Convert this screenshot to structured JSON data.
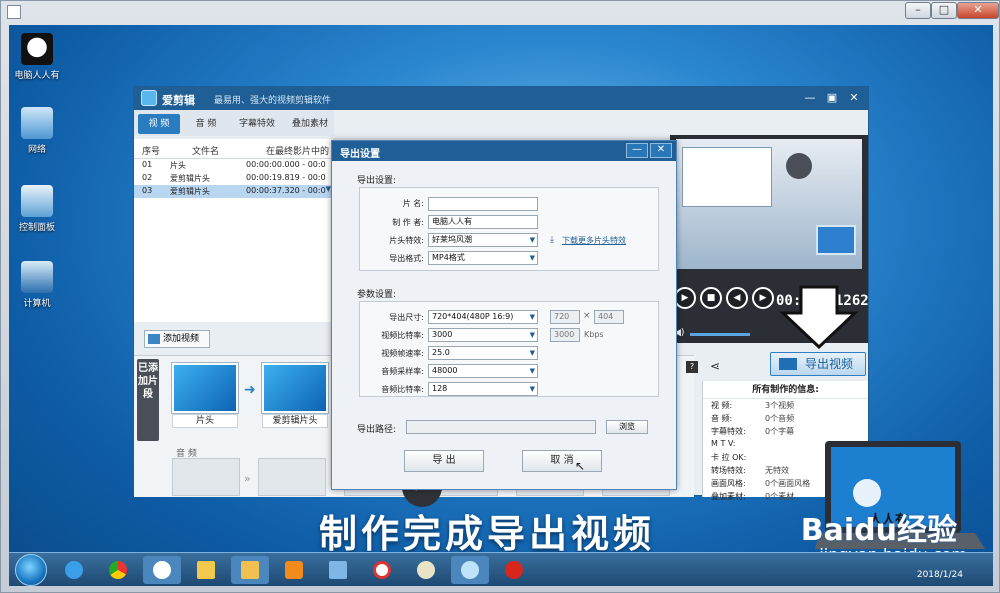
{
  "desktop": {
    "icons": [
      {
        "label": "电脑人人有"
      },
      {
        "label": "网络"
      },
      {
        "label": "控制面板"
      },
      {
        "label": "计算机"
      }
    ],
    "caption": "制作完成导出视频",
    "watermark": "Baidu经验",
    "watermark_url": "jingyan.baidu.com",
    "laptop_text": "人人有",
    "clock_date": "2018/1/24"
  },
  "app": {
    "name": "爱剪辑",
    "slogan": "最易用、强大的视频剪辑软件",
    "tabs": [
      "视 频",
      "音 频",
      "字幕特效",
      "叠加素材"
    ],
    "table": {
      "headers": [
        "序号",
        "文件名",
        "在最终影片中的"
      ],
      "rows": [
        {
          "no": "01",
          "name": "片头",
          "time": "00:00:00.000 - 00:0"
        },
        {
          "no": "02",
          "name": "爱剪辑片头",
          "time": "00:00:19.819 - 00:0"
        },
        {
          "no": "03",
          "name": "爱剪辑片头",
          "time": "00:00:37.320 - 00:0"
        }
      ]
    },
    "add_video": "添加视频",
    "strip_side": "已添加片段",
    "clips": [
      "片头",
      "爱剪辑片头"
    ],
    "audio_label": "音 频",
    "timecode": "00:00:11262",
    "export_button": "导出视频",
    "info": {
      "title": "所有制作的信息:",
      "rows": [
        {
          "k": "视    频:",
          "v": "3个视频"
        },
        {
          "k": "音    频:",
          "v": "0个音频"
        },
        {
          "k": "字幕特效:",
          "v": "0个字幕"
        },
        {
          "k": "M  T  V:",
          "v": ""
        },
        {
          "k": "卡 拉 OK:",
          "v": ""
        },
        {
          "k": "转场特效:",
          "v": "无特效"
        },
        {
          "k": "画面风格:",
          "v": "0个画面风格"
        },
        {
          "k": "叠加素材:",
          "v": "0个素材"
        }
      ]
    }
  },
  "dialog": {
    "title": "导出设置",
    "export_section": "导出设置:",
    "name_label": "片    名:",
    "name_value": "",
    "author_label": "制 作 者:",
    "author_value": "电脑人人有",
    "intro_label": "片头特效:",
    "intro_value": "好莱坞风潮",
    "download_link": "下载更多片头特效",
    "format_label": "导出格式:",
    "format_value": "MP4格式",
    "param_section": "参数设置:",
    "size_label": "导出尺寸:",
    "size_value": "720*404(480P 16:9)",
    "size_w": "720",
    "size_x": "×",
    "size_h": "404",
    "vbitrate_label": "视频比特率:",
    "vbitrate_value": "3000",
    "vbitrate_custom": "3000",
    "kbps": "Kbps",
    "fps_label": "视频帧速率:",
    "fps_value": "25.0",
    "asample_label": "音频采样率:",
    "asample_value": "48000",
    "abitrate_label": "音频比特率:",
    "abitrate_value": "128",
    "path_label": "导出路径:",
    "path_value": "",
    "browse": "浏览",
    "export_btn": "导 出",
    "cancel_btn": "取 消"
  }
}
